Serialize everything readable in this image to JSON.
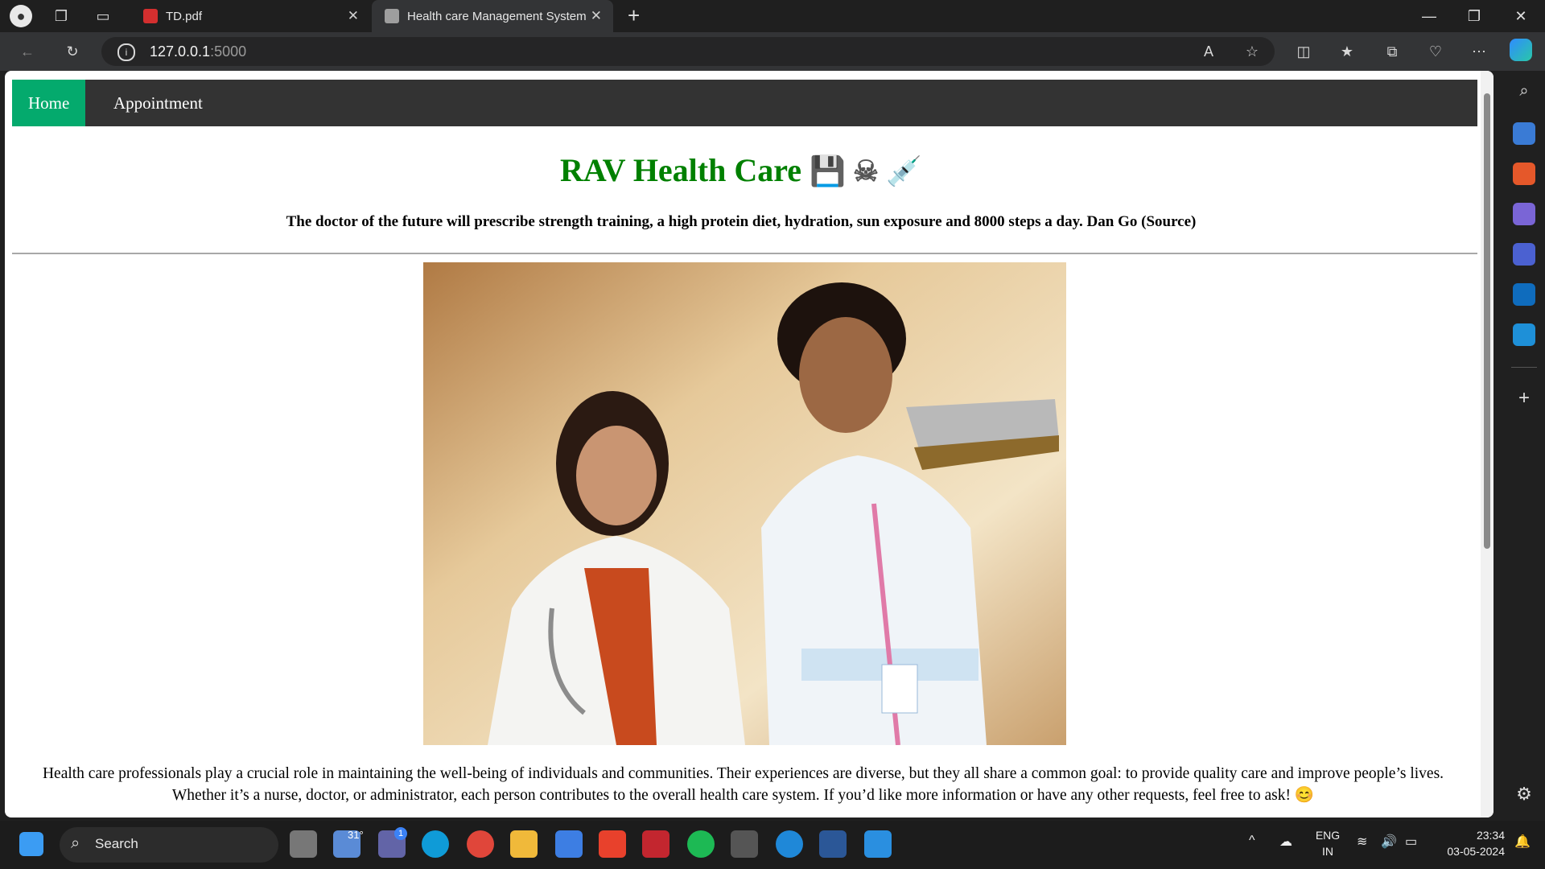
{
  "browser": {
    "tabs": [
      {
        "label": "TD.pdf",
        "active": false
      },
      {
        "label": "Health care Management System",
        "active": true
      }
    ],
    "url_host": "127.0.0.1",
    "url_port": ":5000"
  },
  "page": {
    "nav": [
      {
        "label": "Home",
        "active": true
      },
      {
        "label": "Appointment",
        "active": false
      }
    ],
    "heading": "RAV Health Care",
    "heading_emojis": "💾 ☠ 💉",
    "quote": "The doctor of the future will prescribe strength training, a high protein diet, hydration, sun exposure and 8000 steps a day. Dan Go (Source)",
    "intro": "Health care professionals play a crucial role in maintaining the well-being of individuals and communities. Their experiences are diverse, but they all share a common goal: to provide quality care and improve people’s lives. Whether it’s a nurse, doctor, or administrator, each person contributes to the overall health care system. If you’d like more information or have any other requests, feel free to ask! 😊",
    "colors": {
      "heading": "#008000",
      "nav_bg": "#333333",
      "nav_active": "#04aa6d"
    }
  },
  "taskbar": {
    "search_label": "Search",
    "weather_temp": "31°",
    "chat_badge": "1",
    "lang_line1": "ENG",
    "lang_line2": "IN",
    "time": "23:34",
    "date": "03-05-2024"
  }
}
